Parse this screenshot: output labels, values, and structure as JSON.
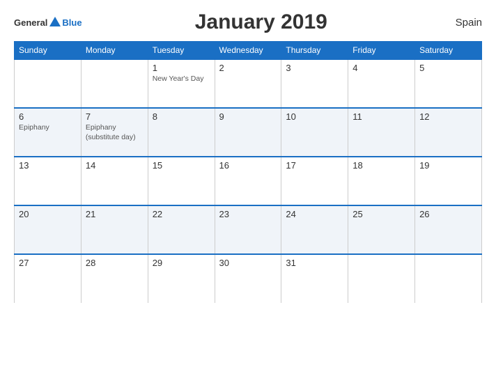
{
  "header": {
    "logo_general": "General",
    "logo_blue": "Blue",
    "title": "January 2019",
    "country": "Spain"
  },
  "calendar": {
    "days_of_week": [
      "Sunday",
      "Monday",
      "Tuesday",
      "Wednesday",
      "Thursday",
      "Friday",
      "Saturday"
    ],
    "weeks": [
      [
        {
          "day": "",
          "events": []
        },
        {
          "day": "",
          "events": []
        },
        {
          "day": "1",
          "events": [
            "New Year's Day"
          ]
        },
        {
          "day": "2",
          "events": []
        },
        {
          "day": "3",
          "events": []
        },
        {
          "day": "4",
          "events": []
        },
        {
          "day": "5",
          "events": []
        }
      ],
      [
        {
          "day": "6",
          "events": [
            "Epiphany"
          ]
        },
        {
          "day": "7",
          "events": [
            "Epiphany",
            "(substitute day)"
          ]
        },
        {
          "day": "8",
          "events": []
        },
        {
          "day": "9",
          "events": []
        },
        {
          "day": "10",
          "events": []
        },
        {
          "day": "11",
          "events": []
        },
        {
          "day": "12",
          "events": []
        }
      ],
      [
        {
          "day": "13",
          "events": []
        },
        {
          "day": "14",
          "events": []
        },
        {
          "day": "15",
          "events": []
        },
        {
          "day": "16",
          "events": []
        },
        {
          "day": "17",
          "events": []
        },
        {
          "day": "18",
          "events": []
        },
        {
          "day": "19",
          "events": []
        }
      ],
      [
        {
          "day": "20",
          "events": []
        },
        {
          "day": "21",
          "events": []
        },
        {
          "day": "22",
          "events": []
        },
        {
          "day": "23",
          "events": []
        },
        {
          "day": "24",
          "events": []
        },
        {
          "day": "25",
          "events": []
        },
        {
          "day": "26",
          "events": []
        }
      ],
      [
        {
          "day": "27",
          "events": []
        },
        {
          "day": "28",
          "events": []
        },
        {
          "day": "29",
          "events": []
        },
        {
          "day": "30",
          "events": []
        },
        {
          "day": "31",
          "events": []
        },
        {
          "day": "",
          "events": []
        },
        {
          "day": "",
          "events": []
        }
      ]
    ]
  }
}
